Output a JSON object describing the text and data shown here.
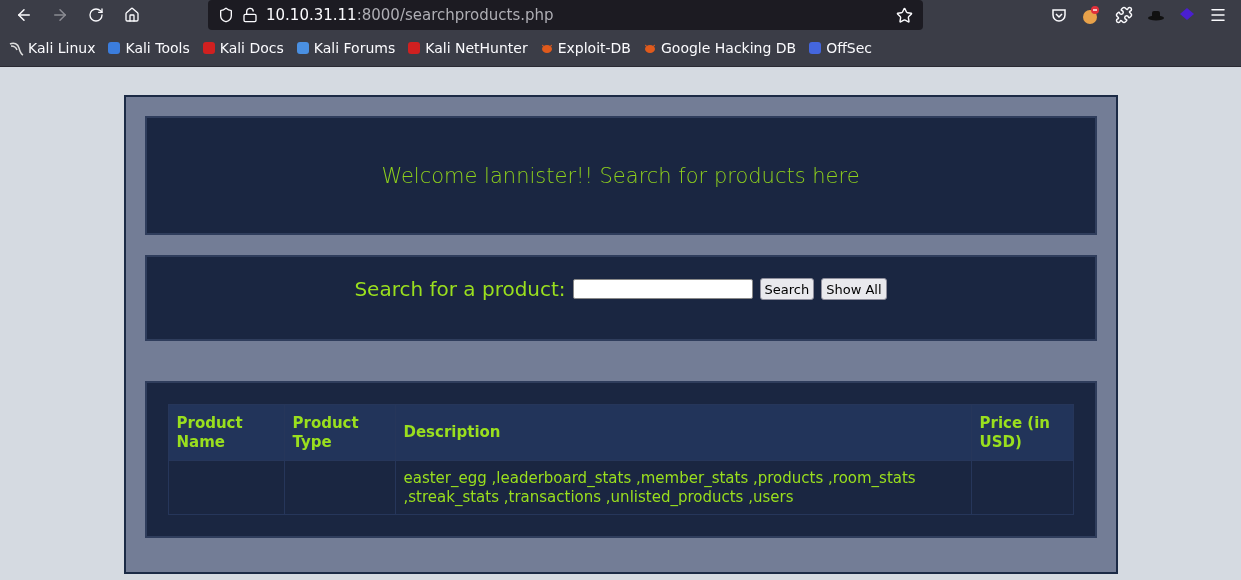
{
  "browser": {
    "url_host": "10.10.31.11",
    "url_rest": ":8000/searchproducts.php",
    "bookmarks": [
      {
        "label": "Kali Linux"
      },
      {
        "label": "Kali Tools"
      },
      {
        "label": "Kali Docs"
      },
      {
        "label": "Kali Forums"
      },
      {
        "label": "Kali NetHunter"
      },
      {
        "label": "Exploit-DB"
      },
      {
        "label": "Google Hacking DB"
      },
      {
        "label": "OffSec"
      }
    ]
  },
  "page": {
    "welcome": "Welcome lannister!! Search for products here",
    "search": {
      "label": "Search for a product:",
      "buttons": [
        "Search",
        "Show All"
      ]
    },
    "table": {
      "columns": [
        "Product Name",
        "Product Type",
        "Description",
        "Price (in USD)"
      ],
      "rows": [
        [
          "",
          "",
          "easter_egg ,leaderboard_stats ,member_stats ,products ,room_stats ,streak_stats ,transactions ,unlisted_products ,users",
          ""
        ]
      ]
    }
  }
}
